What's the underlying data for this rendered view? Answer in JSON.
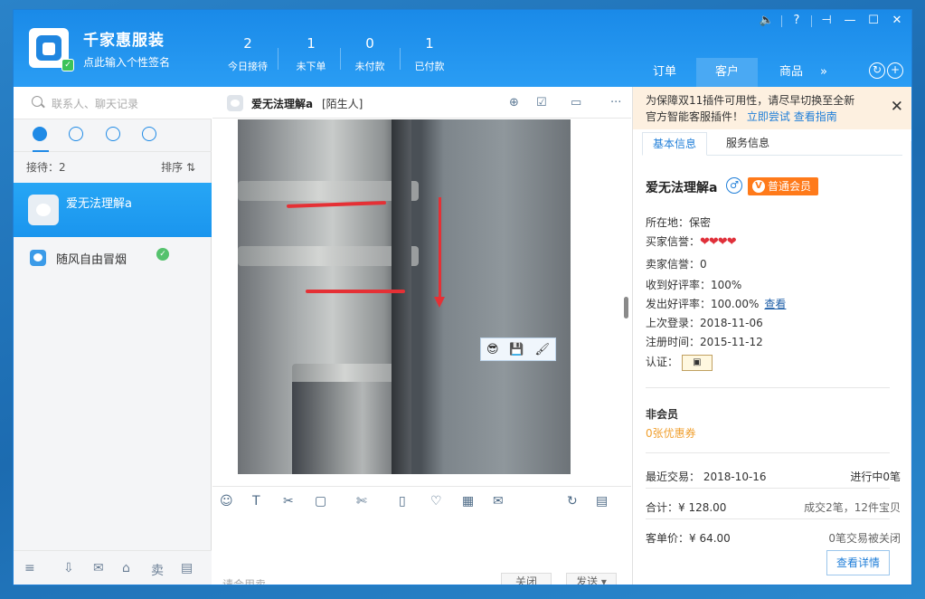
{
  "header": {
    "store_name": "千家惠服装",
    "signature_placeholder": "点此输入个性签名",
    "stats": [
      {
        "value": "2",
        "label": "今日接待"
      },
      {
        "value": "1",
        "label": "未下单"
      },
      {
        "value": "0",
        "label": "未付款"
      },
      {
        "value": "1",
        "label": "已付款"
      }
    ],
    "main_tabs": [
      {
        "label": "订单",
        "active": false
      },
      {
        "label": "客户",
        "active": true
      },
      {
        "label": "商品",
        "active": false
      }
    ],
    "more_glyph": "»",
    "window_controls": [
      "🔈",
      "?",
      "⊣",
      "—",
      "☐",
      "✕"
    ]
  },
  "left": {
    "search_placeholder": "联系人、聊天记录",
    "queue_label": "接待：2",
    "sort_label": "排序 ⇅",
    "contacts": [
      {
        "name": "爱无法理解a",
        "selected": true
      },
      {
        "name": "随风自由冒烟",
        "selected": false,
        "online": true
      }
    ],
    "bottom_icons": [
      "≡",
      "⇩",
      "✉",
      "⌂",
      "卖",
      "▤"
    ]
  },
  "chat": {
    "name": "爱无法理解a",
    "tag": "[陌生人]",
    "header_icons": [
      "⊕",
      "☑",
      "▭",
      "···"
    ],
    "image_tools": [
      "😎",
      "💾",
      "🖌"
    ],
    "toolbar_icons": [
      "☺",
      "T",
      "✂",
      "▢",
      "✄",
      "▯",
      "♡",
      "▦",
      "✉",
      "↻",
      "▤"
    ],
    "input_placeholder": "请合用卖",
    "close_label": "关闭",
    "send_label": "发送 ▾"
  },
  "right": {
    "notice_line1": "为保障双11插件可用性，请尽早切换至全新",
    "notice_line2": "官方智能客服插件！",
    "notice_try": "立即尝试",
    "notice_guide": "查看指南",
    "tabs": [
      {
        "label": "基本信息",
        "active": true
      },
      {
        "label": "服务信息",
        "active": false
      }
    ],
    "customer_name": "爱无法理解a",
    "gender_glyph": "♂",
    "vip_label": "普通会员",
    "location": "所在地：保密",
    "buyer_credit_label": "买家信誉：",
    "buyer_credit_hearts": "❤❤❤❤",
    "seller_credit": "卖家信誉：0",
    "received_rate": "收到好评率：100%",
    "given_rate": "发出好评率：100.00%",
    "view_label": "查看",
    "last_login": "上次登录：2018-11-06",
    "register_time": "注册时间：2015-11-12",
    "cert_label": "认证：",
    "member_status": "非会员",
    "coupons": "0张优惠券",
    "recent_trade": "最近交易： 2018-10-16",
    "in_progress": "进行中0笔",
    "total": "合计：¥ 128.00",
    "deals": "成交2笔，12件宝贝",
    "avg_order": "客单价：¥ 64.00",
    "closed_deals": "0笔交易被关闭",
    "detail_button": "查看详情"
  },
  "colors": {
    "accent": "#1f8ae6",
    "header_blue": "#2a9df4",
    "vip_orange": "#ff7a1a",
    "notice_bg": "#fdf0e0",
    "online_green": "#55c26d"
  }
}
